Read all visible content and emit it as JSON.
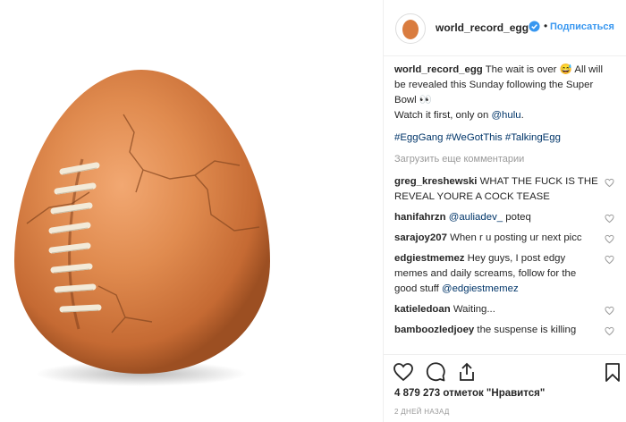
{
  "post": {
    "username": "world_record_egg",
    "follow_label": "Подписаться",
    "separator": "•"
  },
  "caption": {
    "user": "world_record_egg",
    "text1": " The wait is over ",
    "emoji1": "😅",
    "text2": " All will be revealed this Sunday following the Super Bowl ",
    "emoji2": "👀",
    "line2": "Watch it first, only on ",
    "mention": "@hulu",
    "line2_end": ".",
    "tags": "#EggGang #WeGotThis #TalkingEgg"
  },
  "load_more": "Загрузить еще комментарии",
  "comments": [
    {
      "user": "greg_kreshewski",
      "pre": "",
      "mention": "",
      "text": " WHAT THE FUCK IS THE REVEAL YOURE A COCK TEASE"
    },
    {
      "user": "hanifahrzn",
      "pre": " ",
      "mention": "@auliadev_",
      "text": " poteq"
    },
    {
      "user": "sarajoy207",
      "pre": "",
      "mention": "",
      "text": " When r u posting ur next picc"
    },
    {
      "user": "edgiestmemez",
      "pre": "",
      "mention": "",
      "text": " Hey guys, I post edgy memes and daily screams, follow for the good stuff ",
      "mention2": "@edgiestmemez"
    },
    {
      "user": "katieledoan",
      "pre": "",
      "mention": "",
      "text": " Waiting..."
    },
    {
      "user": "bamboozledjoey",
      "pre": "",
      "mention": "",
      "text": " the suspense is killing"
    }
  ],
  "likes": "4 879 273 отметок \"Нравится\"",
  "date": "2 ДНЕЙ НАЗАД",
  "icons": [
    "heart-icon",
    "comment-icon",
    "share-icon",
    "bookmark-icon",
    "verified-icon"
  ],
  "colors": {
    "link": "#003569",
    "follow": "#3897f0",
    "egg": "#d97c3f",
    "verified": "#3897f0"
  }
}
